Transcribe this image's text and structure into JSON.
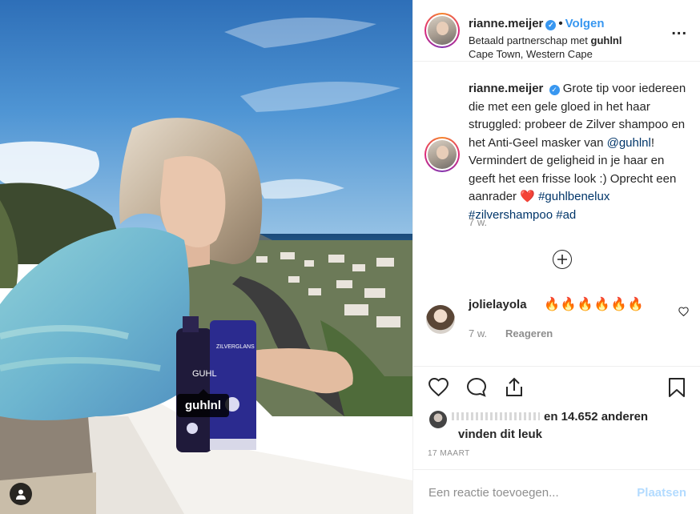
{
  "post": {
    "username": "rianne.meijer",
    "verified_mark": "✓",
    "separator": "•",
    "follow_label": "Volgen",
    "partnership_prefix": "Betaald partnerschap met",
    "partner_account": "guhlnl",
    "location": "Cape Town, Western Cape",
    "more_label": "..."
  },
  "photo": {
    "product_tag": "guhlnl",
    "bottle_brand": "GUHL",
    "tube_text": "ZILVERGLANS"
  },
  "caption": {
    "username": "rianne.meijer",
    "text_1": "Grote tip voor iedereen die met een gele gloed in het haar struggled: probeer de Zilver shampoo en het Anti-Geel masker van",
    "mention": "@guhlnl",
    "text_2": "! Vermindert de geligheid in je haar en geeft het een frisse look :) Oprecht een aanrader",
    "heart": "❤️",
    "hashtag_1": "#guhlbenelux",
    "hashtag_2": "#zilvershampoo",
    "hashtag_3": "#ad",
    "time": "7 w."
  },
  "comment": {
    "username": "jolielayola",
    "emojis": "🔥🔥🔥🔥🔥🔥",
    "time": "7 w.",
    "reply_label": "Reageren"
  },
  "likes": {
    "count_text": "en 14.652 anderen",
    "suffix": "vinden dit leuk",
    "date": "17 MAART"
  },
  "add_comment": {
    "placeholder": "Een reactie toevoegen...",
    "post_label": "Plaatsen"
  },
  "colors": {
    "accent": "#3897f0",
    "link": "#003569",
    "muted": "#8e8e8e"
  }
}
